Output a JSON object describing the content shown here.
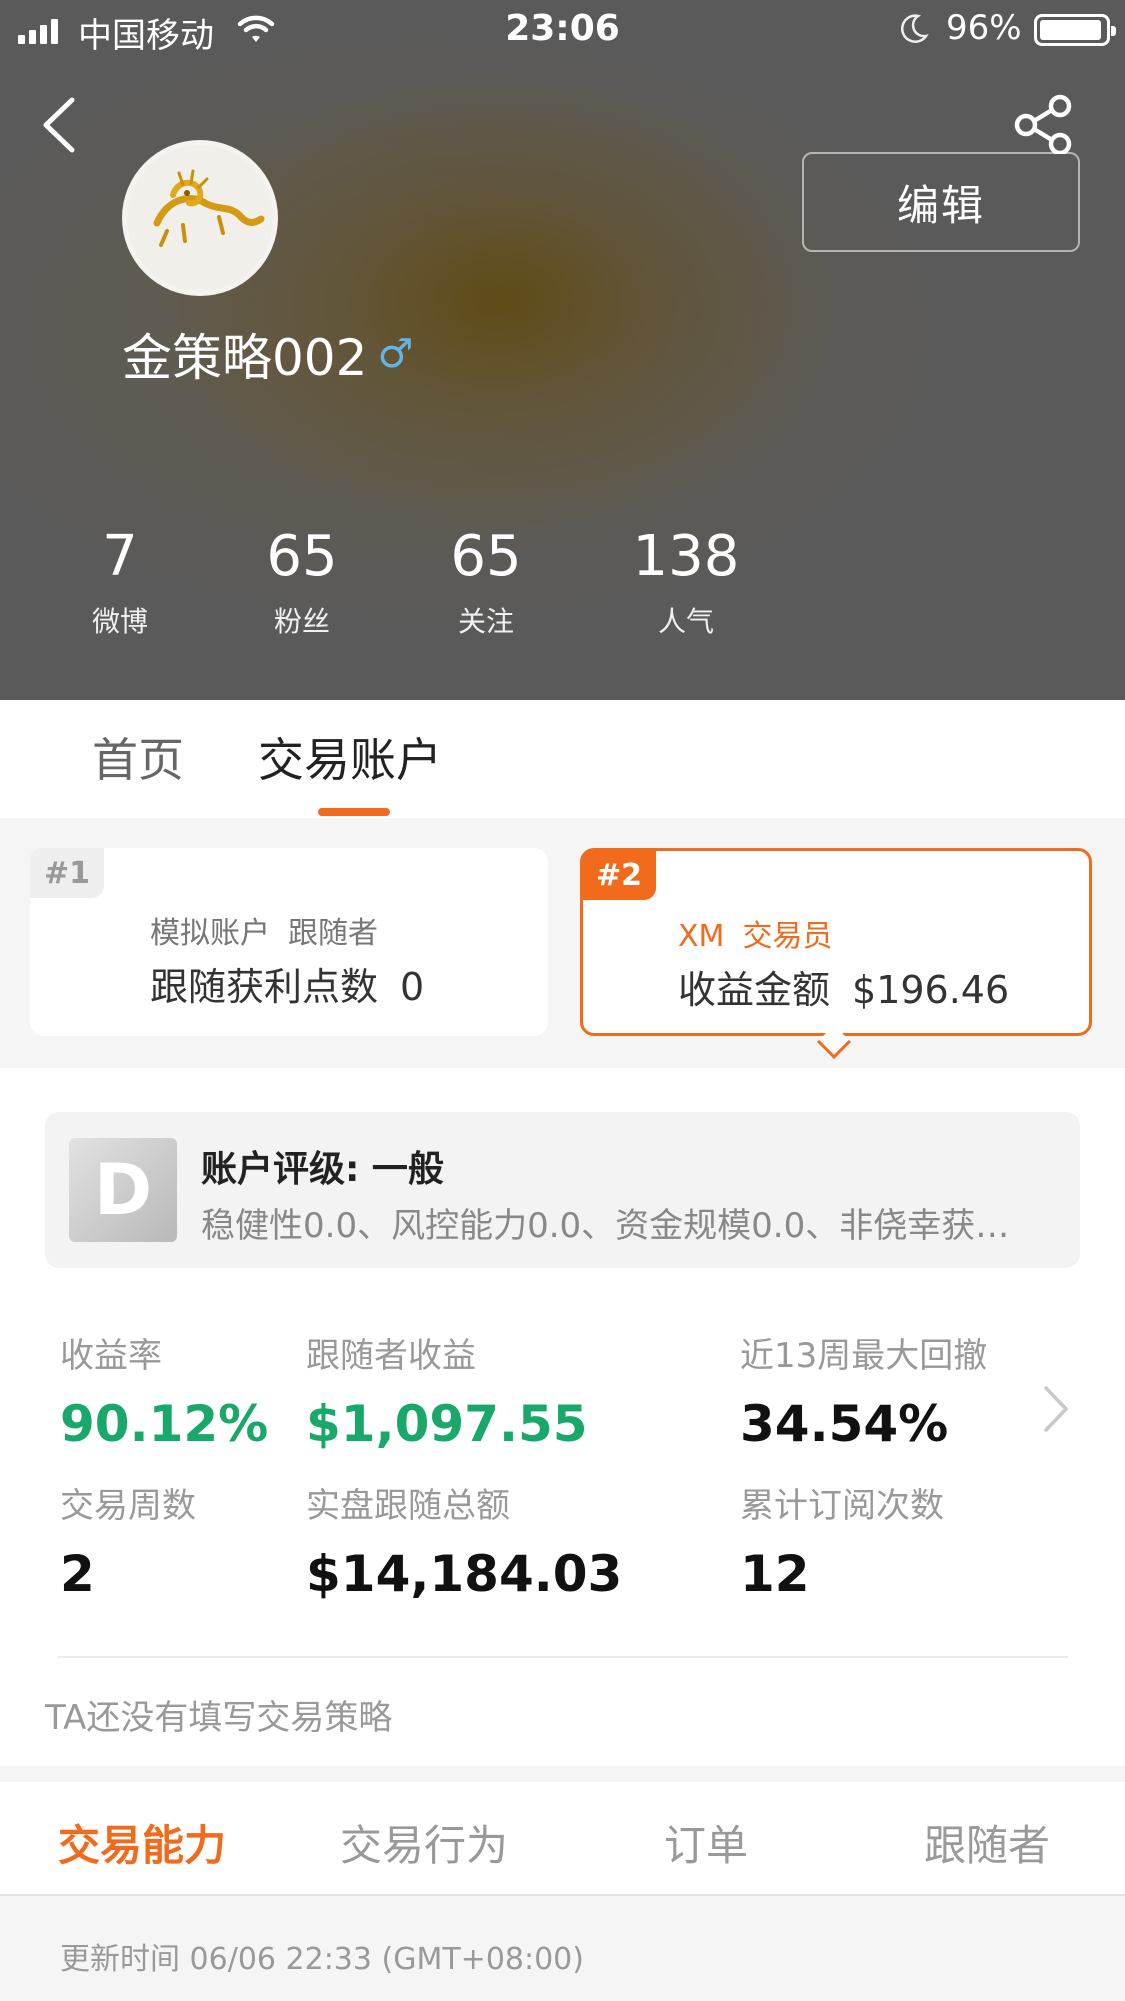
{
  "status_bar": {
    "carrier": "中国移动",
    "time": "23:06",
    "battery": "96%",
    "battery_level": 0.96
  },
  "profile": {
    "edit_label": "编辑",
    "username": "金策略002",
    "gender_symbol": "♂",
    "stats": [
      {
        "value": "7",
        "label": "微博"
      },
      {
        "value": "65",
        "label": "粉丝"
      },
      {
        "value": "65",
        "label": "关注"
      },
      {
        "value": "138",
        "label": "人气"
      }
    ]
  },
  "tabs": [
    {
      "label": "首页"
    },
    {
      "label": "交易账户"
    }
  ],
  "accounts": [
    {
      "tag": "#1",
      "type": "模拟账户",
      "role": "跟随者",
      "metric_label": "跟随获利点数",
      "metric_value": "0"
    },
    {
      "tag": "#2",
      "type": "XM",
      "role": "交易员",
      "metric_label": "收益金额",
      "metric_value": "$196.46"
    }
  ],
  "rating": {
    "badge": "D",
    "title": "账户评级: 一般",
    "description": "稳健性0.0、风控能力0.0、资金规模0.0、非侥幸获…"
  },
  "metrics": [
    {
      "label": "收益率",
      "value": "90.12%"
    },
    {
      "label": "跟随者收益",
      "value": "$1,097.55"
    },
    {
      "label": "近13周最大回撤",
      "value": "34.54%"
    },
    {
      "label": "交易周数",
      "value": "2"
    },
    {
      "label": "实盘跟随总额",
      "value": "$14,184.03"
    },
    {
      "label": "累计订阅次数",
      "value": "12"
    }
  ],
  "strategy_text": "TA还没有填写交易策略",
  "subtabs": [
    {
      "label": "交易能力"
    },
    {
      "label": "交易行为"
    },
    {
      "label": "订单"
    },
    {
      "label": "跟随者"
    }
  ],
  "update_time": "更新时间 06/06 22:33 (GMT+08:00)",
  "colors": {
    "accent": "#f26b1d",
    "positive": "#17a86a",
    "gender": "#62b6e6"
  }
}
